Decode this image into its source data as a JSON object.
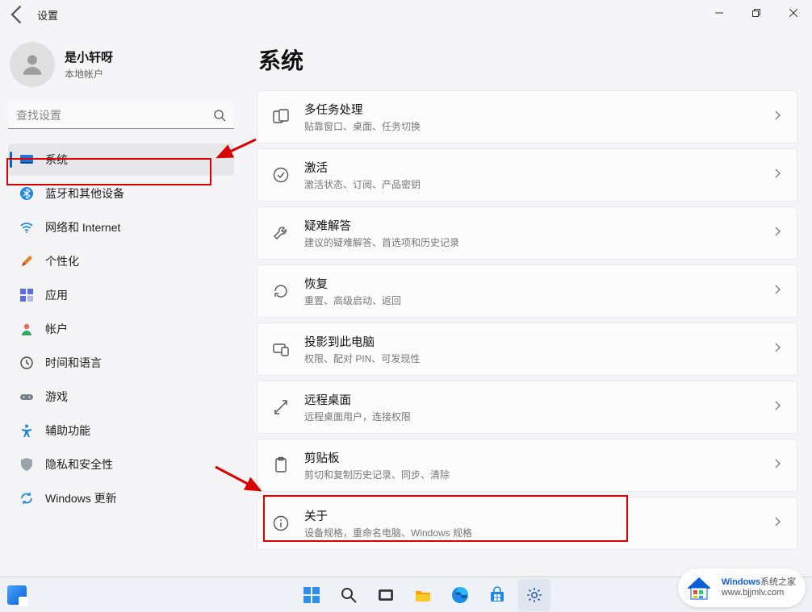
{
  "titlebar": {
    "title": "设置"
  },
  "profile": {
    "name": "是小轩呀",
    "sub": "本地帐户"
  },
  "search": {
    "placeholder": "查找设置"
  },
  "nav": {
    "items": [
      {
        "label": "系统",
        "selected": true
      },
      {
        "label": "蓝牙和其他设备"
      },
      {
        "label": "网络和 Internet"
      },
      {
        "label": "个性化"
      },
      {
        "label": "应用"
      },
      {
        "label": "帐户"
      },
      {
        "label": "时间和语言"
      },
      {
        "label": "游戏"
      },
      {
        "label": "辅助功能"
      },
      {
        "label": "隐私和安全性"
      },
      {
        "label": "Windows 更新"
      }
    ]
  },
  "page": {
    "title": "系统"
  },
  "cards": [
    {
      "title": "多任务处理",
      "sub": "贴靠窗口、桌面、任务切换"
    },
    {
      "title": "激活",
      "sub": "激活状态、订阅、产品密钥"
    },
    {
      "title": "疑难解答",
      "sub": "建议的疑难解答、首选项和历史记录"
    },
    {
      "title": "恢复",
      "sub": "重置、高级启动、返回"
    },
    {
      "title": "投影到此电脑",
      "sub": "权限、配对 PIN、可发现性"
    },
    {
      "title": "远程桌面",
      "sub": "远程桌面用户，连接权限"
    },
    {
      "title": "剪贴板",
      "sub": "剪切和复制历史记录、同步、清除"
    },
    {
      "title": "关于",
      "sub": "设备规格，重命名电脑、Windows 规格"
    }
  ],
  "watermark": {
    "brand": "Windows",
    "suffix": "系统之家",
    "url": "www.bjjmlv.com"
  }
}
